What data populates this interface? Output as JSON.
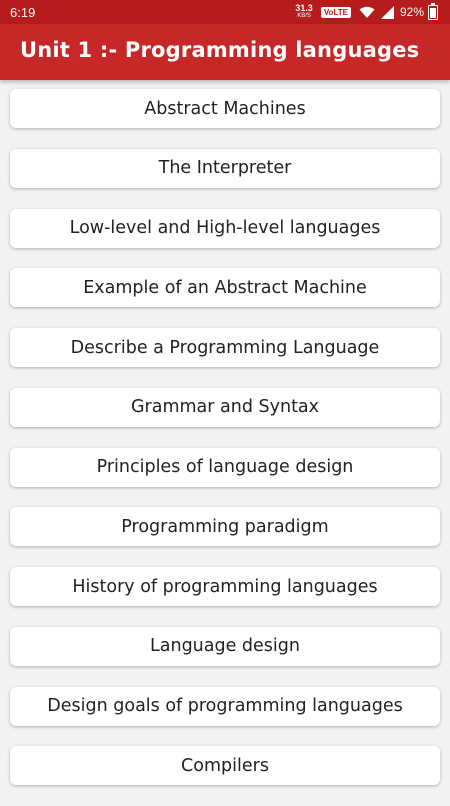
{
  "status_bar": {
    "time": "6:19",
    "net_speed": "31.3",
    "net_unit": "KB/S",
    "volte": "VoLTE",
    "battery": "92%"
  },
  "app_bar": {
    "title": "Unit 1 :- Programming languages",
    "color": "#c62828"
  },
  "topics": [
    "Abstract Machines",
    "The Interpreter",
    "Low-level and High-level languages",
    "Example of an Abstract Machine",
    "Describe a Programming Language",
    "Grammar and Syntax",
    "Principles of language design",
    "Programming paradigm",
    "History of programming languages",
    "Language design",
    "Design goals of programming languages",
    "Compilers"
  ]
}
